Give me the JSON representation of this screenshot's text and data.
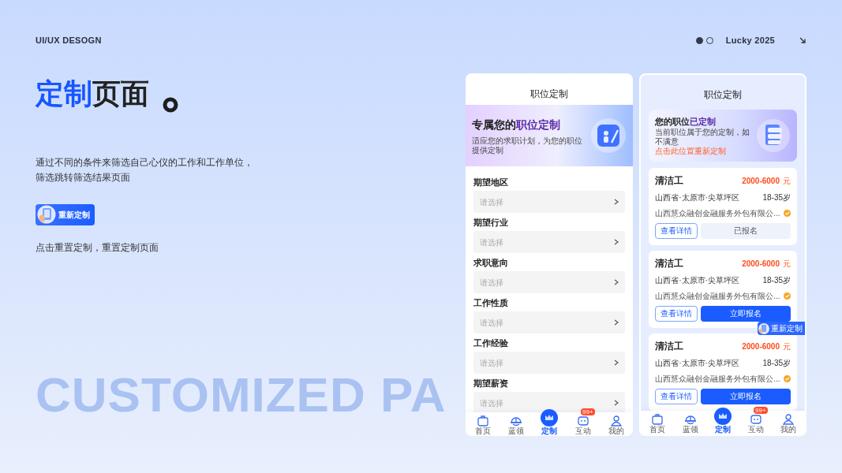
{
  "header": {
    "brand": "UI/UX DESOGN",
    "pager": [
      {
        "selected": true
      },
      {
        "selected": false
      }
    ],
    "year": "Lucky 2025"
  },
  "intro": {
    "title_highlight": "定制",
    "title_rest": "页面",
    "description": [
      "通过不同的条件来筛选自己心仪的工作和工作单位，",
      "筛选跳转筛选结果页面"
    ],
    "button_label": "重新定制",
    "caption": "点击重置定制，重置定制页面"
  },
  "background_text": "CUSTOMIZED PA",
  "form_screen": {
    "title": "职位定制",
    "banner": {
      "title_prefix": "专属您的",
      "title_highlight": "职位定制",
      "subtitle": "适应您的求职计划，为您的职位提供定制"
    },
    "fields": [
      {
        "label": "期望地区",
        "placeholder": "请选择"
      },
      {
        "label": "期望行业",
        "placeholder": "请选择"
      },
      {
        "label": "求职意向",
        "placeholder": "请选择"
      },
      {
        "label": "工作性质",
        "placeholder": "请选择"
      },
      {
        "label": "工作经验",
        "placeholder": "请选择"
      },
      {
        "label": "期望薪资",
        "placeholder": "请选择"
      }
    ],
    "tab_bar": [
      {
        "label": "首页",
        "selected": false
      },
      {
        "label": "蓝领",
        "selected": false
      },
      {
        "label": "定制",
        "selected": true
      },
      {
        "label": "互动",
        "selected": false,
        "badge": "99+"
      },
      {
        "label": "我的",
        "selected": false
      }
    ]
  },
  "results_screen": {
    "title": "职位定制",
    "banner": {
      "title_prefix": "您的职位",
      "title_highlight": "已定制",
      "subtitle": "当前职位属于您的定制，如不满意",
      "link": "点击此位置重新定制"
    },
    "jobs": [
      {
        "title": "清洁工",
        "salary": "2000-6000",
        "unit": "元",
        "location": "山西省·太原市·尖草坪区",
        "age": "18-35岁",
        "company": "山西慧众融创金融服务外包有限公...",
        "verified": true,
        "details_button": "查看详情",
        "apply_button": "已报名",
        "applied": true
      },
      {
        "title": "清洁工",
        "salary": "2000-6000",
        "unit": "元",
        "location": "山西省·太原市·尖草坪区",
        "age": "18-35岁",
        "company": "山西慧众融创金融服务外包有限公...",
        "verified": true,
        "details_button": "查看详情",
        "apply_button": "立即报名",
        "applied": false
      },
      {
        "title": "清洁工",
        "salary": "2000-6000",
        "unit": "元",
        "location": "山西省·太原市·尖草坪区",
        "age": "18-35岁",
        "company": "山西慧众融创金融服务外包有限公...",
        "verified": true,
        "details_button": "查看详情",
        "apply_button": "立即报名",
        "applied": false
      }
    ],
    "float_button": "重新定制",
    "tab_bar": [
      {
        "label": "首页",
        "selected": false
      },
      {
        "label": "蓝领",
        "selected": false
      },
      {
        "label": "定制",
        "selected": true
      },
      {
        "label": "互动",
        "selected": false,
        "badge": "99+"
      },
      {
        "label": "我的",
        "selected": false
      }
    ]
  }
}
